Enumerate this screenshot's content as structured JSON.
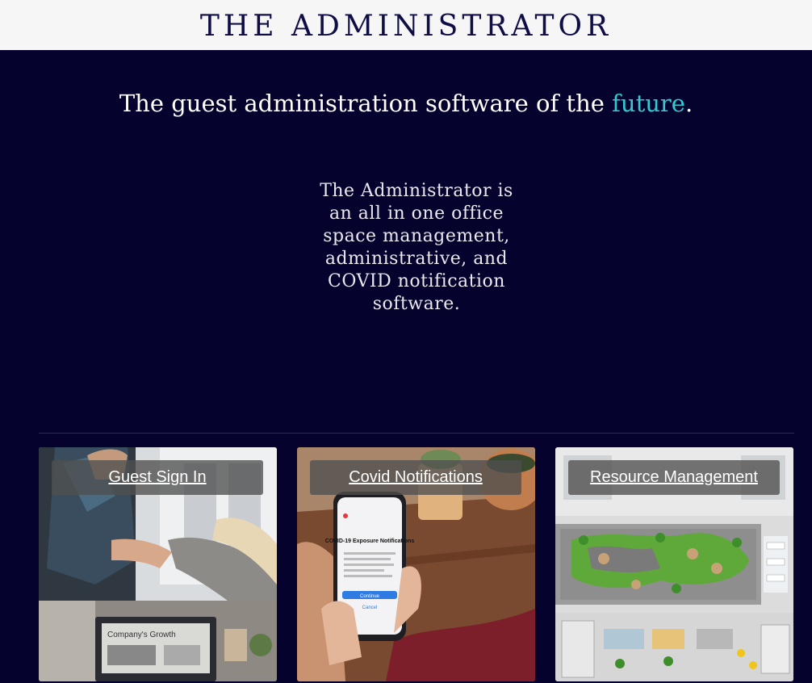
{
  "header": {
    "title": "THE ADMINISTRATOR"
  },
  "hero": {
    "tagline_before": "The guest administration software of the ",
    "tagline_accent": "future",
    "tagline_after": ".",
    "description": "The Administrator is an all in one office space management, administrative, and COVID notification software."
  },
  "cards": [
    {
      "label": "Guest Sign In",
      "image": "handshake-office-photo"
    },
    {
      "label": "Covid Notifications",
      "image": "phone-covid-exposure-photo"
    },
    {
      "label": "Resource Management",
      "image": "office-floor-plan-photo"
    }
  ],
  "phone_screen": {
    "title": "COVID-19 Exposure Notifications",
    "button": "Continue",
    "cancel": "Cancel"
  },
  "laptop_screen": {
    "title": "Company's Growth"
  },
  "colors": {
    "background": "#05032d",
    "header_bg": "#f6f6f6",
    "title": "#0f0d45",
    "accent": "#33c9d1"
  }
}
